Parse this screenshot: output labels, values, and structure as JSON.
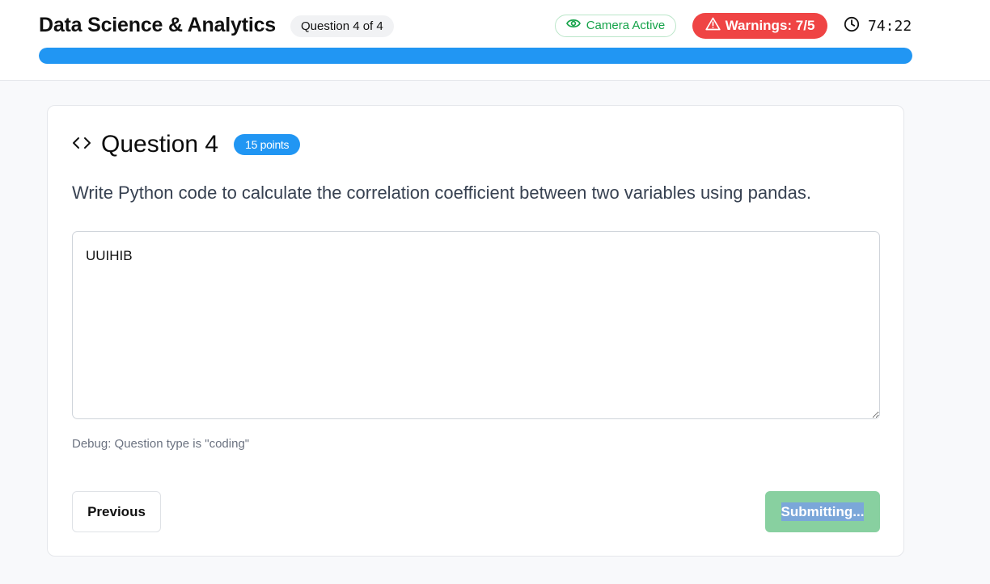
{
  "header": {
    "exam_title": "Data Science & Analytics",
    "question_counter": "Question 4 of 4",
    "camera_status": "Camera Active",
    "warnings_label": "Warnings: 7/5",
    "timer": "74:22",
    "progress_fraction": 1.0,
    "colors": {
      "progress": "#2196f3",
      "warning": "#ef4444",
      "camera": "#16a34a"
    }
  },
  "question": {
    "title": "Question 4",
    "points": "15 points",
    "text": "Write Python code to calculate the correlation coefficient between two variables using pandas.",
    "answer": "UUIHIB",
    "debug": "Debug: Question type is \"coding\""
  },
  "nav": {
    "previous_label": "Previous",
    "submit_label": "Submitting..."
  },
  "icons": {
    "camera": "eye-icon",
    "warning": "warning-triangle-icon",
    "timer": "clock-icon",
    "question_type": "code-icon"
  }
}
